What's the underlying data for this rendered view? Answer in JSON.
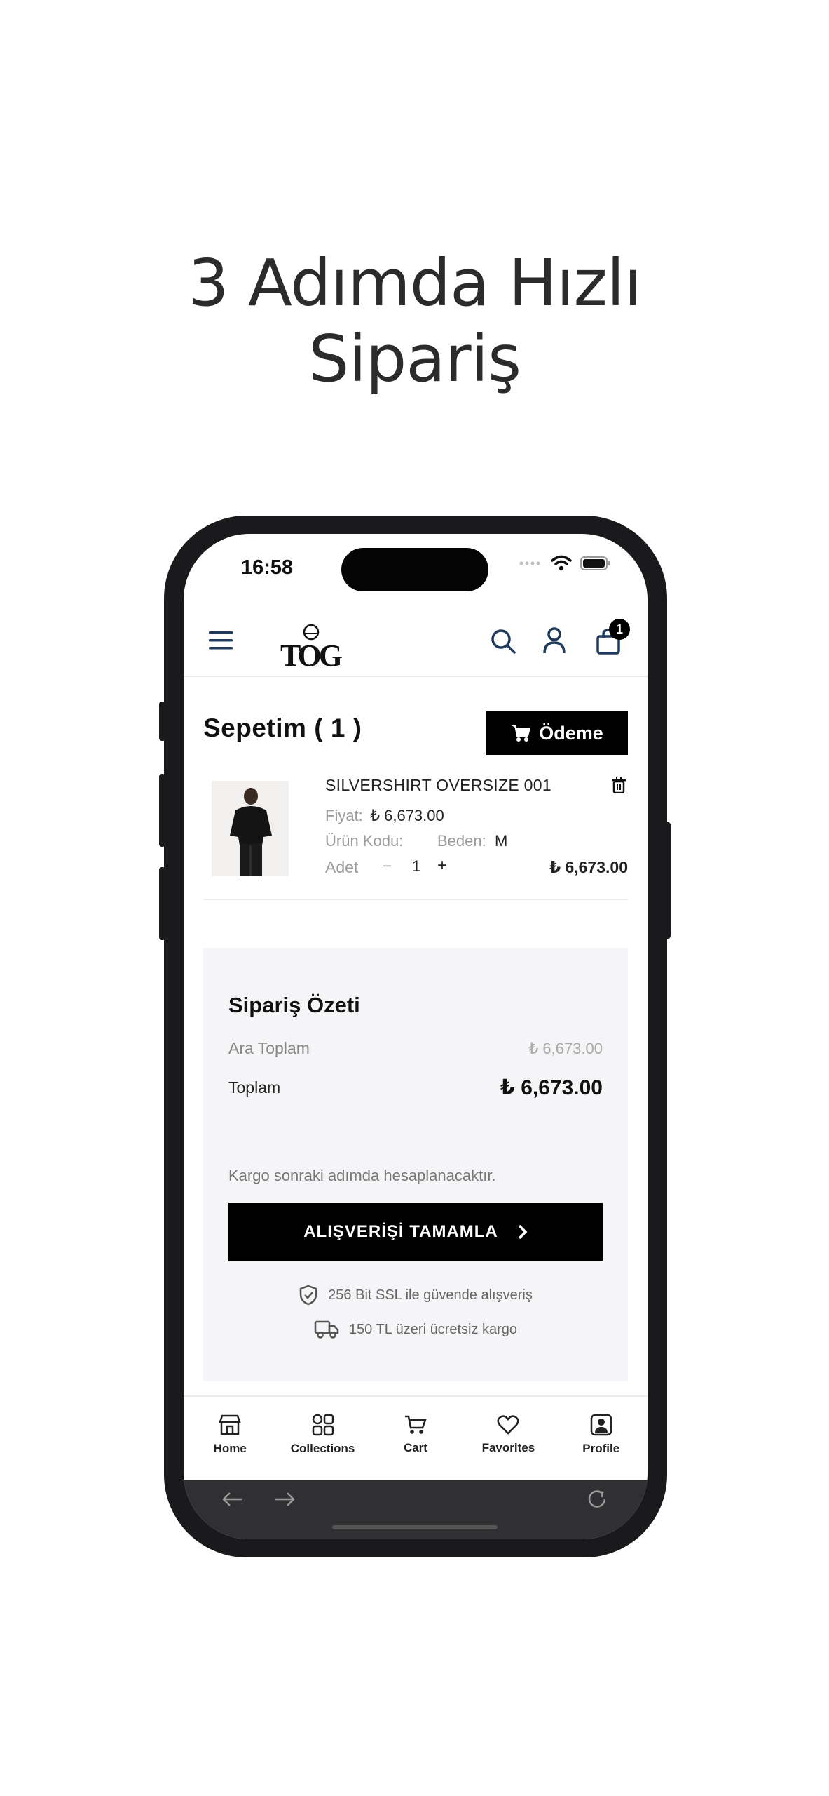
{
  "headline": {
    "line1": "3 Adımda Hızlı",
    "line2": "Sipariş"
  },
  "status": {
    "time": "16:58"
  },
  "header": {
    "logo": "TOG",
    "cart_badge": "1",
    "icons": [
      "menu-icon",
      "search-icon",
      "user-icon",
      "bag-icon"
    ]
  },
  "cart": {
    "title": "Sepetim ( 1 )",
    "pay_label": "Ödeme",
    "item": {
      "name": "SILVERSHIRT OVERSIZE 001",
      "price_label": "Fiyat:",
      "price": "₺ 6,673.00",
      "code_label": "Ürün Kodu:",
      "size_label": "Beden:",
      "size": "M",
      "qty_label": "Adet",
      "minus": "−",
      "qty": "1",
      "plus": "+",
      "total": "₺ 6,673.00"
    }
  },
  "summary": {
    "title": "Sipariş Özeti",
    "subtotal_label": "Ara Toplam",
    "subtotal": "₺ 6,673.00",
    "total_label": "Toplam",
    "total": "₺ 6,673.00",
    "shipping_note": "Kargo sonraki adımda hesaplanacaktır.",
    "complete_label": "ALIŞVERİŞİ TAMAMLA",
    "ssl_note": "256 Bit SSL ile güvende alışveriş",
    "cargo_note": "150 TL üzeri ücretsiz kargo"
  },
  "tabs": [
    {
      "label": "Home",
      "icon": "store-icon"
    },
    {
      "label": "Collections",
      "icon": "grid-icon"
    },
    {
      "label": "Cart",
      "icon": "cart-icon"
    },
    {
      "label": "Favorites",
      "icon": "heart-icon"
    },
    {
      "label": "Profile",
      "icon": "profile-icon"
    }
  ],
  "colors": {
    "accent": "#000000",
    "summary_bg": "#f5f4f6",
    "header_icon": "#1f3a5a"
  }
}
